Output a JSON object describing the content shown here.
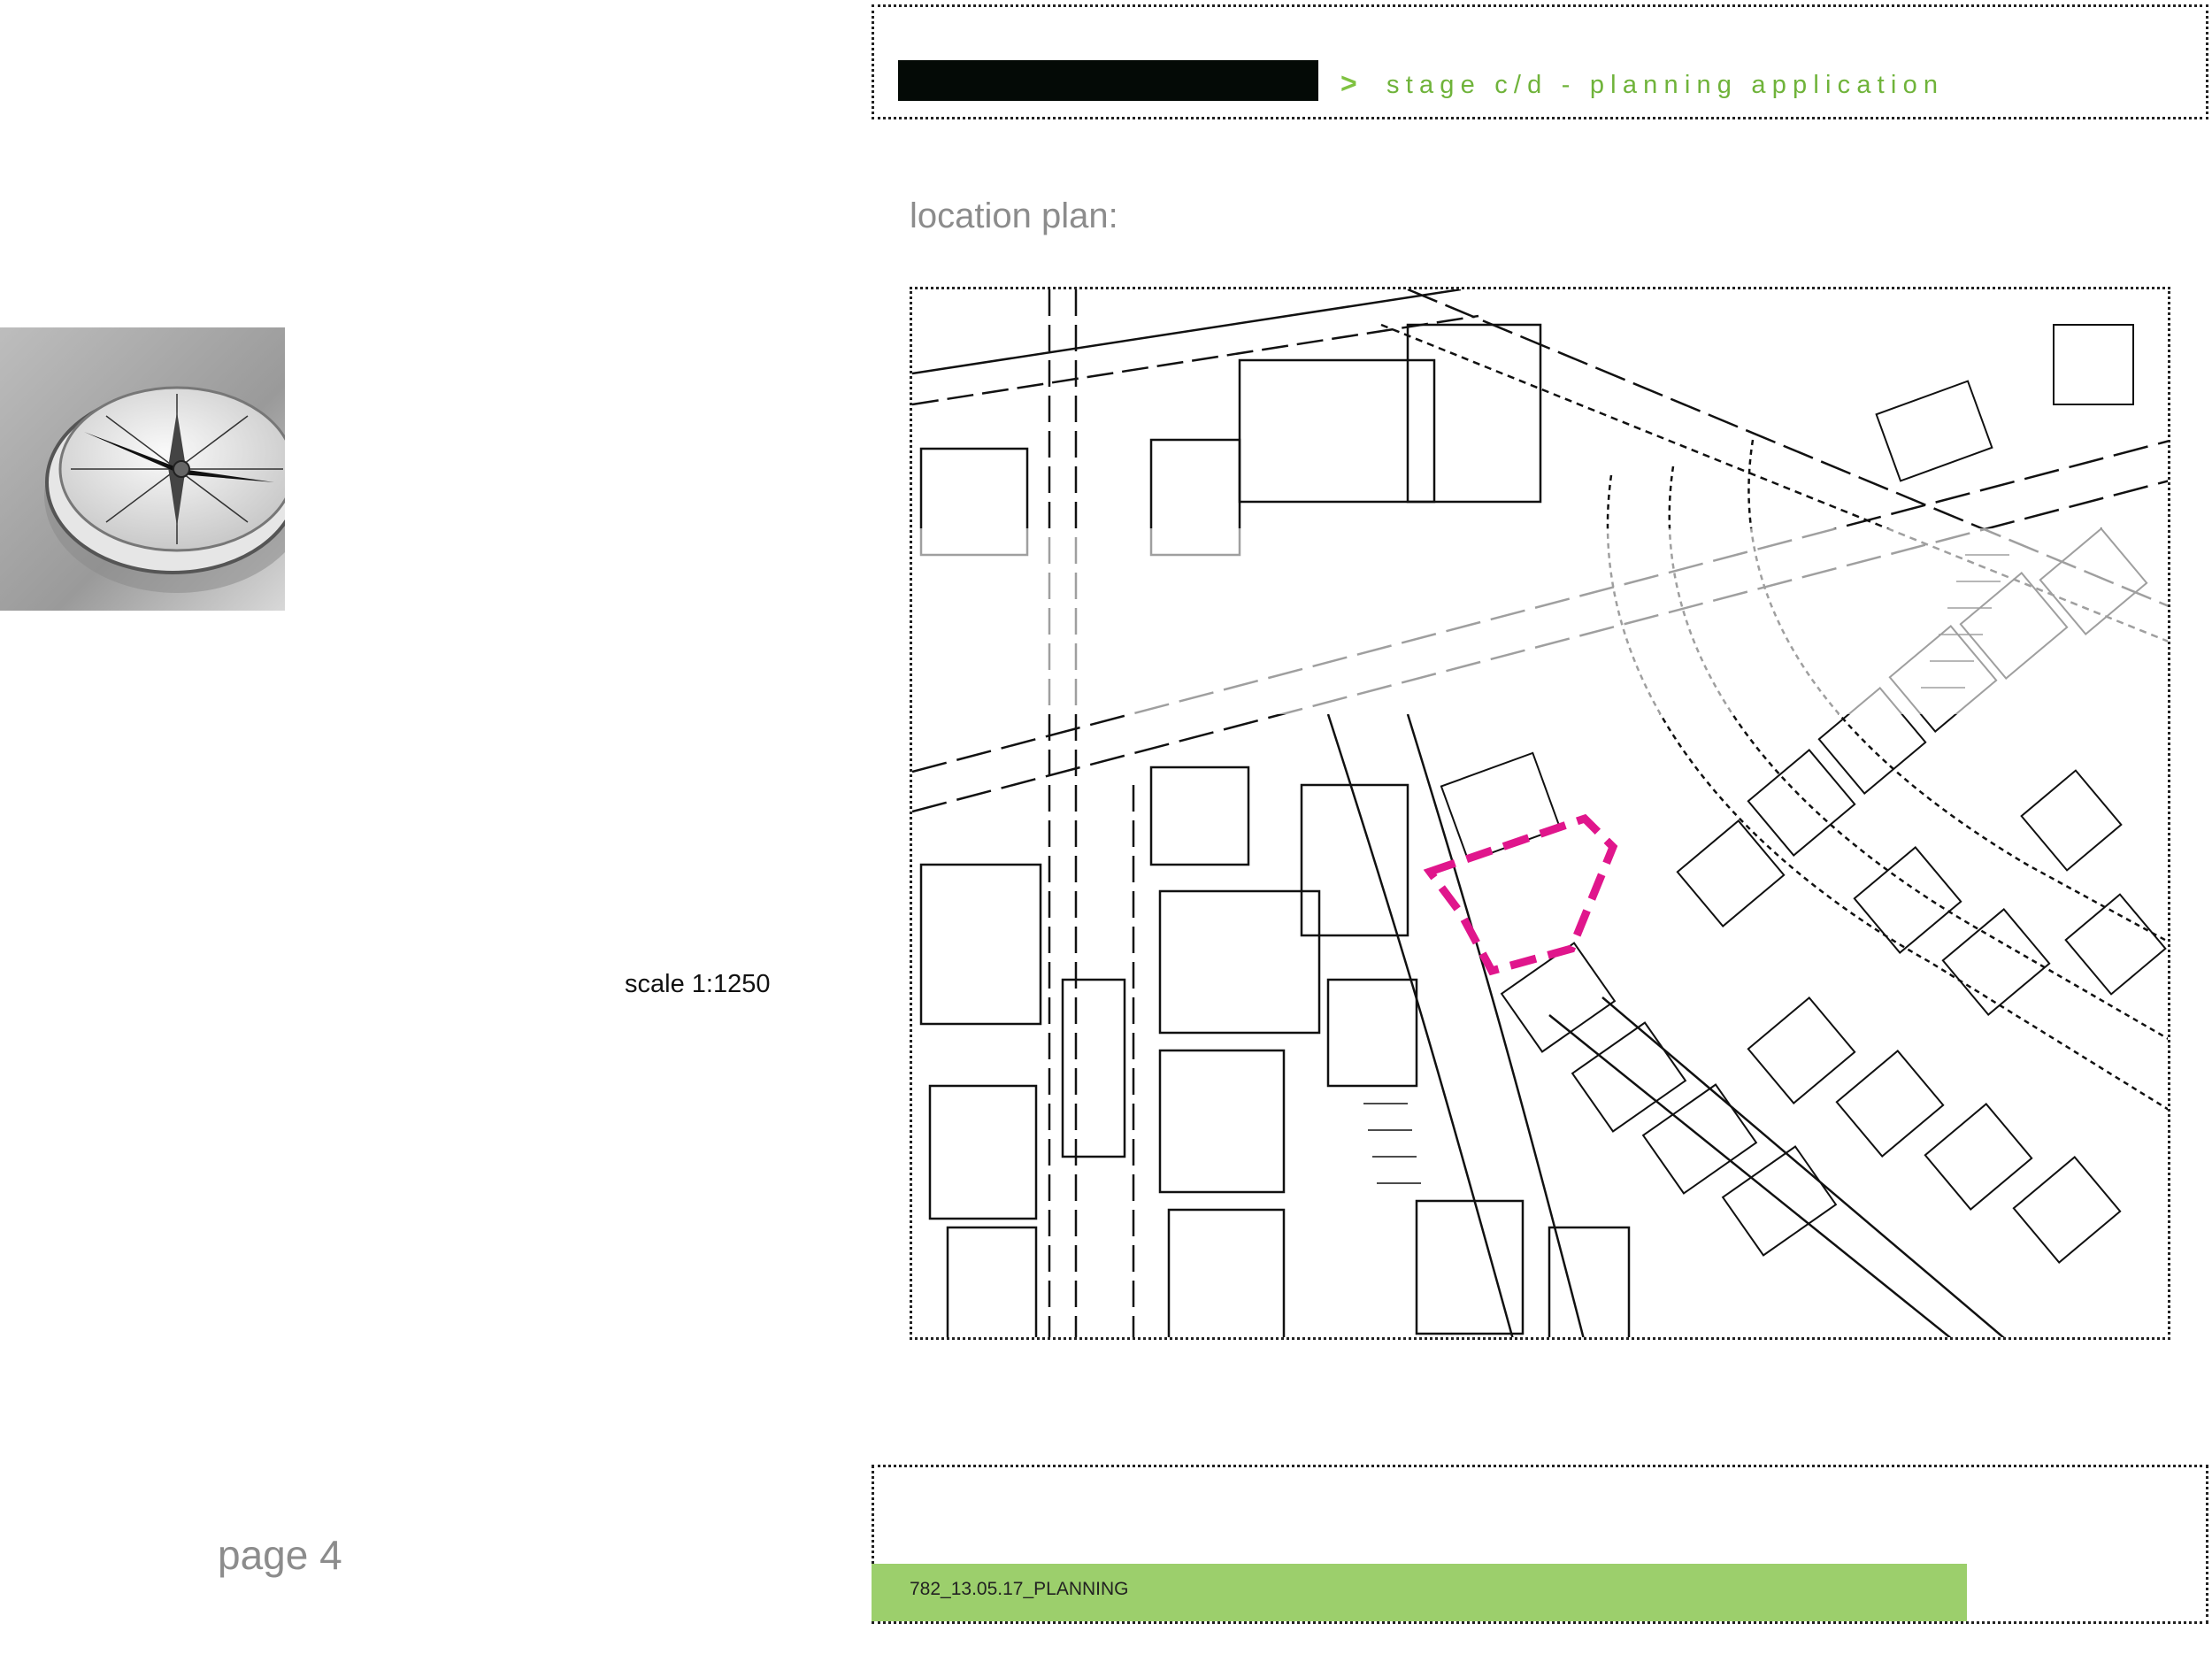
{
  "header": {
    "arrow": ">",
    "stage": "stage c/d - planning application"
  },
  "section": {
    "title": "location plan:"
  },
  "map": {
    "scale": "scale 1:1250",
    "site_boundary_color": "#e0168c"
  },
  "page": {
    "number": "page 4"
  },
  "footer": {
    "code": "782_13.05.17_PLANNING",
    "bar_color": "#9ccf6c"
  },
  "colors": {
    "accent": "#6fb33a",
    "muted_text": "#8c8c8c"
  }
}
